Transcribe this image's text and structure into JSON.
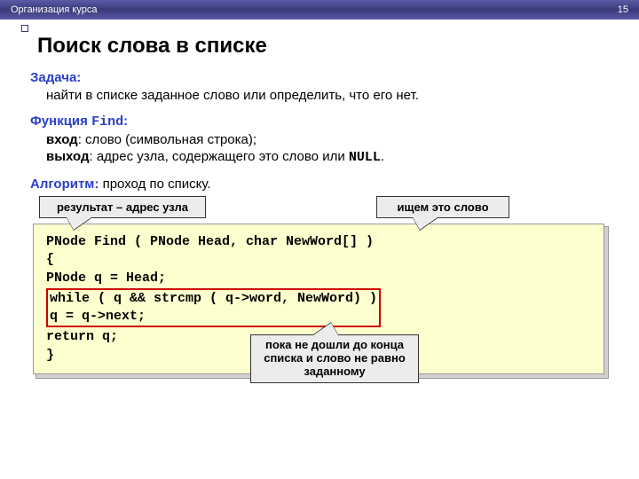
{
  "header": {
    "breadcrumb": "Организация курса",
    "page": "15"
  },
  "title": "Поиск слова в списке",
  "task": {
    "label": "Задача:",
    "text": "найти в списке заданное слово или определить, что его нет."
  },
  "func": {
    "label": "Функция ",
    "name": "Find",
    "colon": ":",
    "in_label": "вход",
    "in_text": ":   слово (символьная строка);",
    "out_label": "выход",
    "out_text": ": адрес узла, содержащего это слово или ",
    "null": "NULL",
    "dot": "."
  },
  "algo": {
    "label": "Алгоритм:",
    "text": " проход по списку."
  },
  "callouts": {
    "result": "результат – адрес узла",
    "search": "ищем это слово",
    "while": "пока не дошли до конца списка и слово не равно заданному"
  },
  "code": {
    "l1": "PNode Find ( PNode Head, char NewWord[] )",
    "l2": "{",
    "l3": "  PNode q = Head;",
    "l4a": " while ( q && strcmp ( q->word, NewWord) )",
    "l4b": "    q = q->next;",
    "l5": "  return q;",
    "l6": "}"
  }
}
